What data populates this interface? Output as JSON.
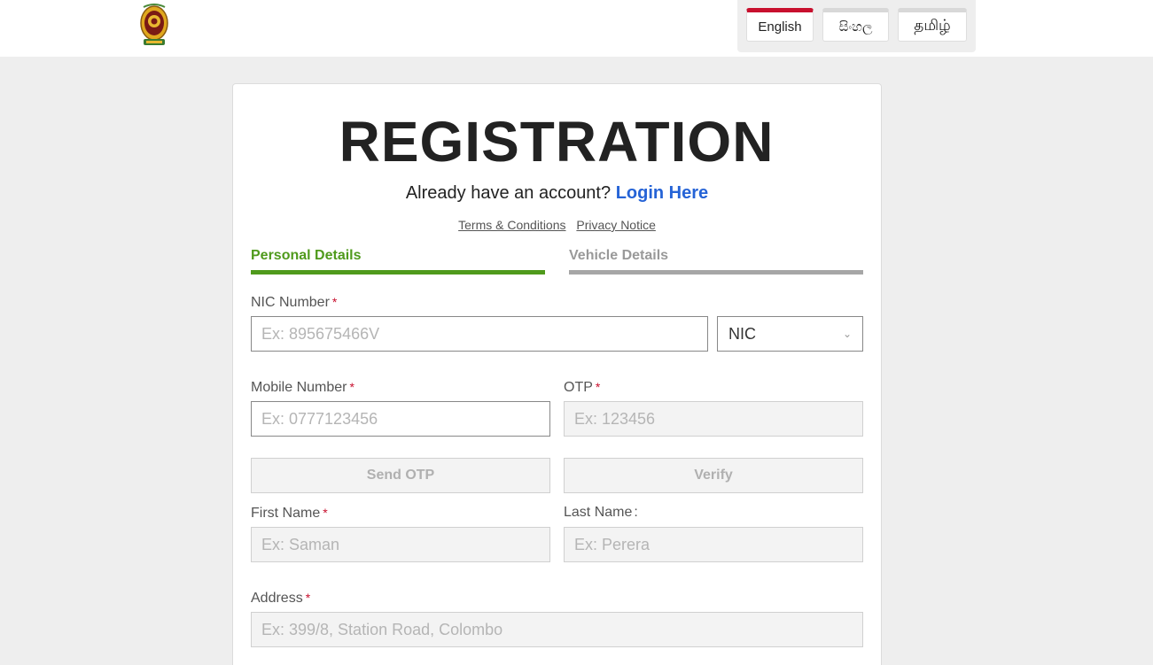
{
  "languages": [
    {
      "label": "English",
      "active": true
    },
    {
      "label": "සිංහල",
      "active": false
    },
    {
      "label": "தமிழ்",
      "active": false
    }
  ],
  "form": {
    "title": "REGISTRATION",
    "login_prompt": "Already have an account?",
    "login_link": "Login Here",
    "terms_link": "Terms & Conditions",
    "privacy_link": "Privacy Notice",
    "tabs": [
      {
        "label": "Personal Details",
        "active": true
      },
      {
        "label": "Vehicle Details",
        "active": false
      }
    ],
    "fields": {
      "nic_label": "NIC Number",
      "nic_placeholder": "Ex: 895675466V",
      "id_type_value": "NIC",
      "mobile_label": "Mobile Number",
      "mobile_placeholder": "Ex: 0777123456",
      "otp_label": "OTP",
      "otp_placeholder": "Ex: 123456",
      "send_otp_label": "Send OTP",
      "verify_label": "Verify",
      "first_name_label": "First Name",
      "first_name_placeholder": "Ex: Saman",
      "last_name_label": "Last Name",
      "last_name_colon": ":",
      "last_name_placeholder": "Ex: Perera",
      "address_label": "Address",
      "address_placeholder": "Ex: 399/8, Station Road, Colombo",
      "required_mark": "*"
    }
  },
  "colors": {
    "accent_green": "#4f9a1c",
    "link_blue": "#2563d6",
    "required_red": "#c8102e"
  }
}
